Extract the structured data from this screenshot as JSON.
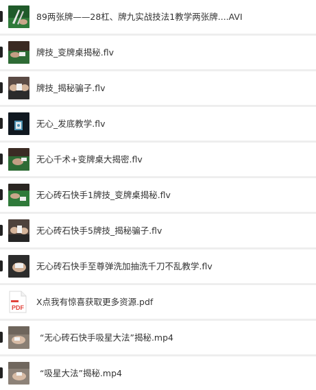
{
  "files": [
    {
      "name": "89两张牌——28杠、牌九实战技法1教学两张牌....AVI",
      "icon": "video-thumbnail-green-table"
    },
    {
      "name": "牌技_变牌桌揭秘.flv",
      "icon": "video-thumbnail-green-table"
    },
    {
      "name": "牌技_揭秘骗子.flv",
      "icon": "video-thumbnail-cards-hands"
    },
    {
      "name": "无心_发底教学.flv",
      "icon": "video-thumbnail-dark-cards"
    },
    {
      "name": "无心千术+变牌桌大揭密.flv",
      "icon": "video-thumbnail-green-table"
    },
    {
      "name": "无心砖石快手1牌技_变牌桌揭秘.flv",
      "icon": "video-thumbnail-green-table"
    },
    {
      "name": "无心砖石快手5牌技_揭秘骗子.flv",
      "icon": "video-thumbnail-cards-hands"
    },
    {
      "name": "无心砖石快手至尊弹洗加抽洗千刀不乱教学.flv",
      "icon": "video-thumbnail-dark-cards"
    },
    {
      "name": "X点我有惊喜获取更多资源.pdf",
      "icon": "pdf-icon"
    },
    {
      "name": "“无心砖石快手吸星大法”揭秘.mp4",
      "icon": "video-thumbnail-hands"
    },
    {
      "name": "“吸星大法”揭秘.mp4",
      "icon": "video-thumbnail-hands"
    }
  ],
  "pdf_label": "PDF",
  "colors": {
    "background": "#eeeeee",
    "row": "#ffffff",
    "text": "#333333",
    "pdf_red": "#e0423a"
  }
}
